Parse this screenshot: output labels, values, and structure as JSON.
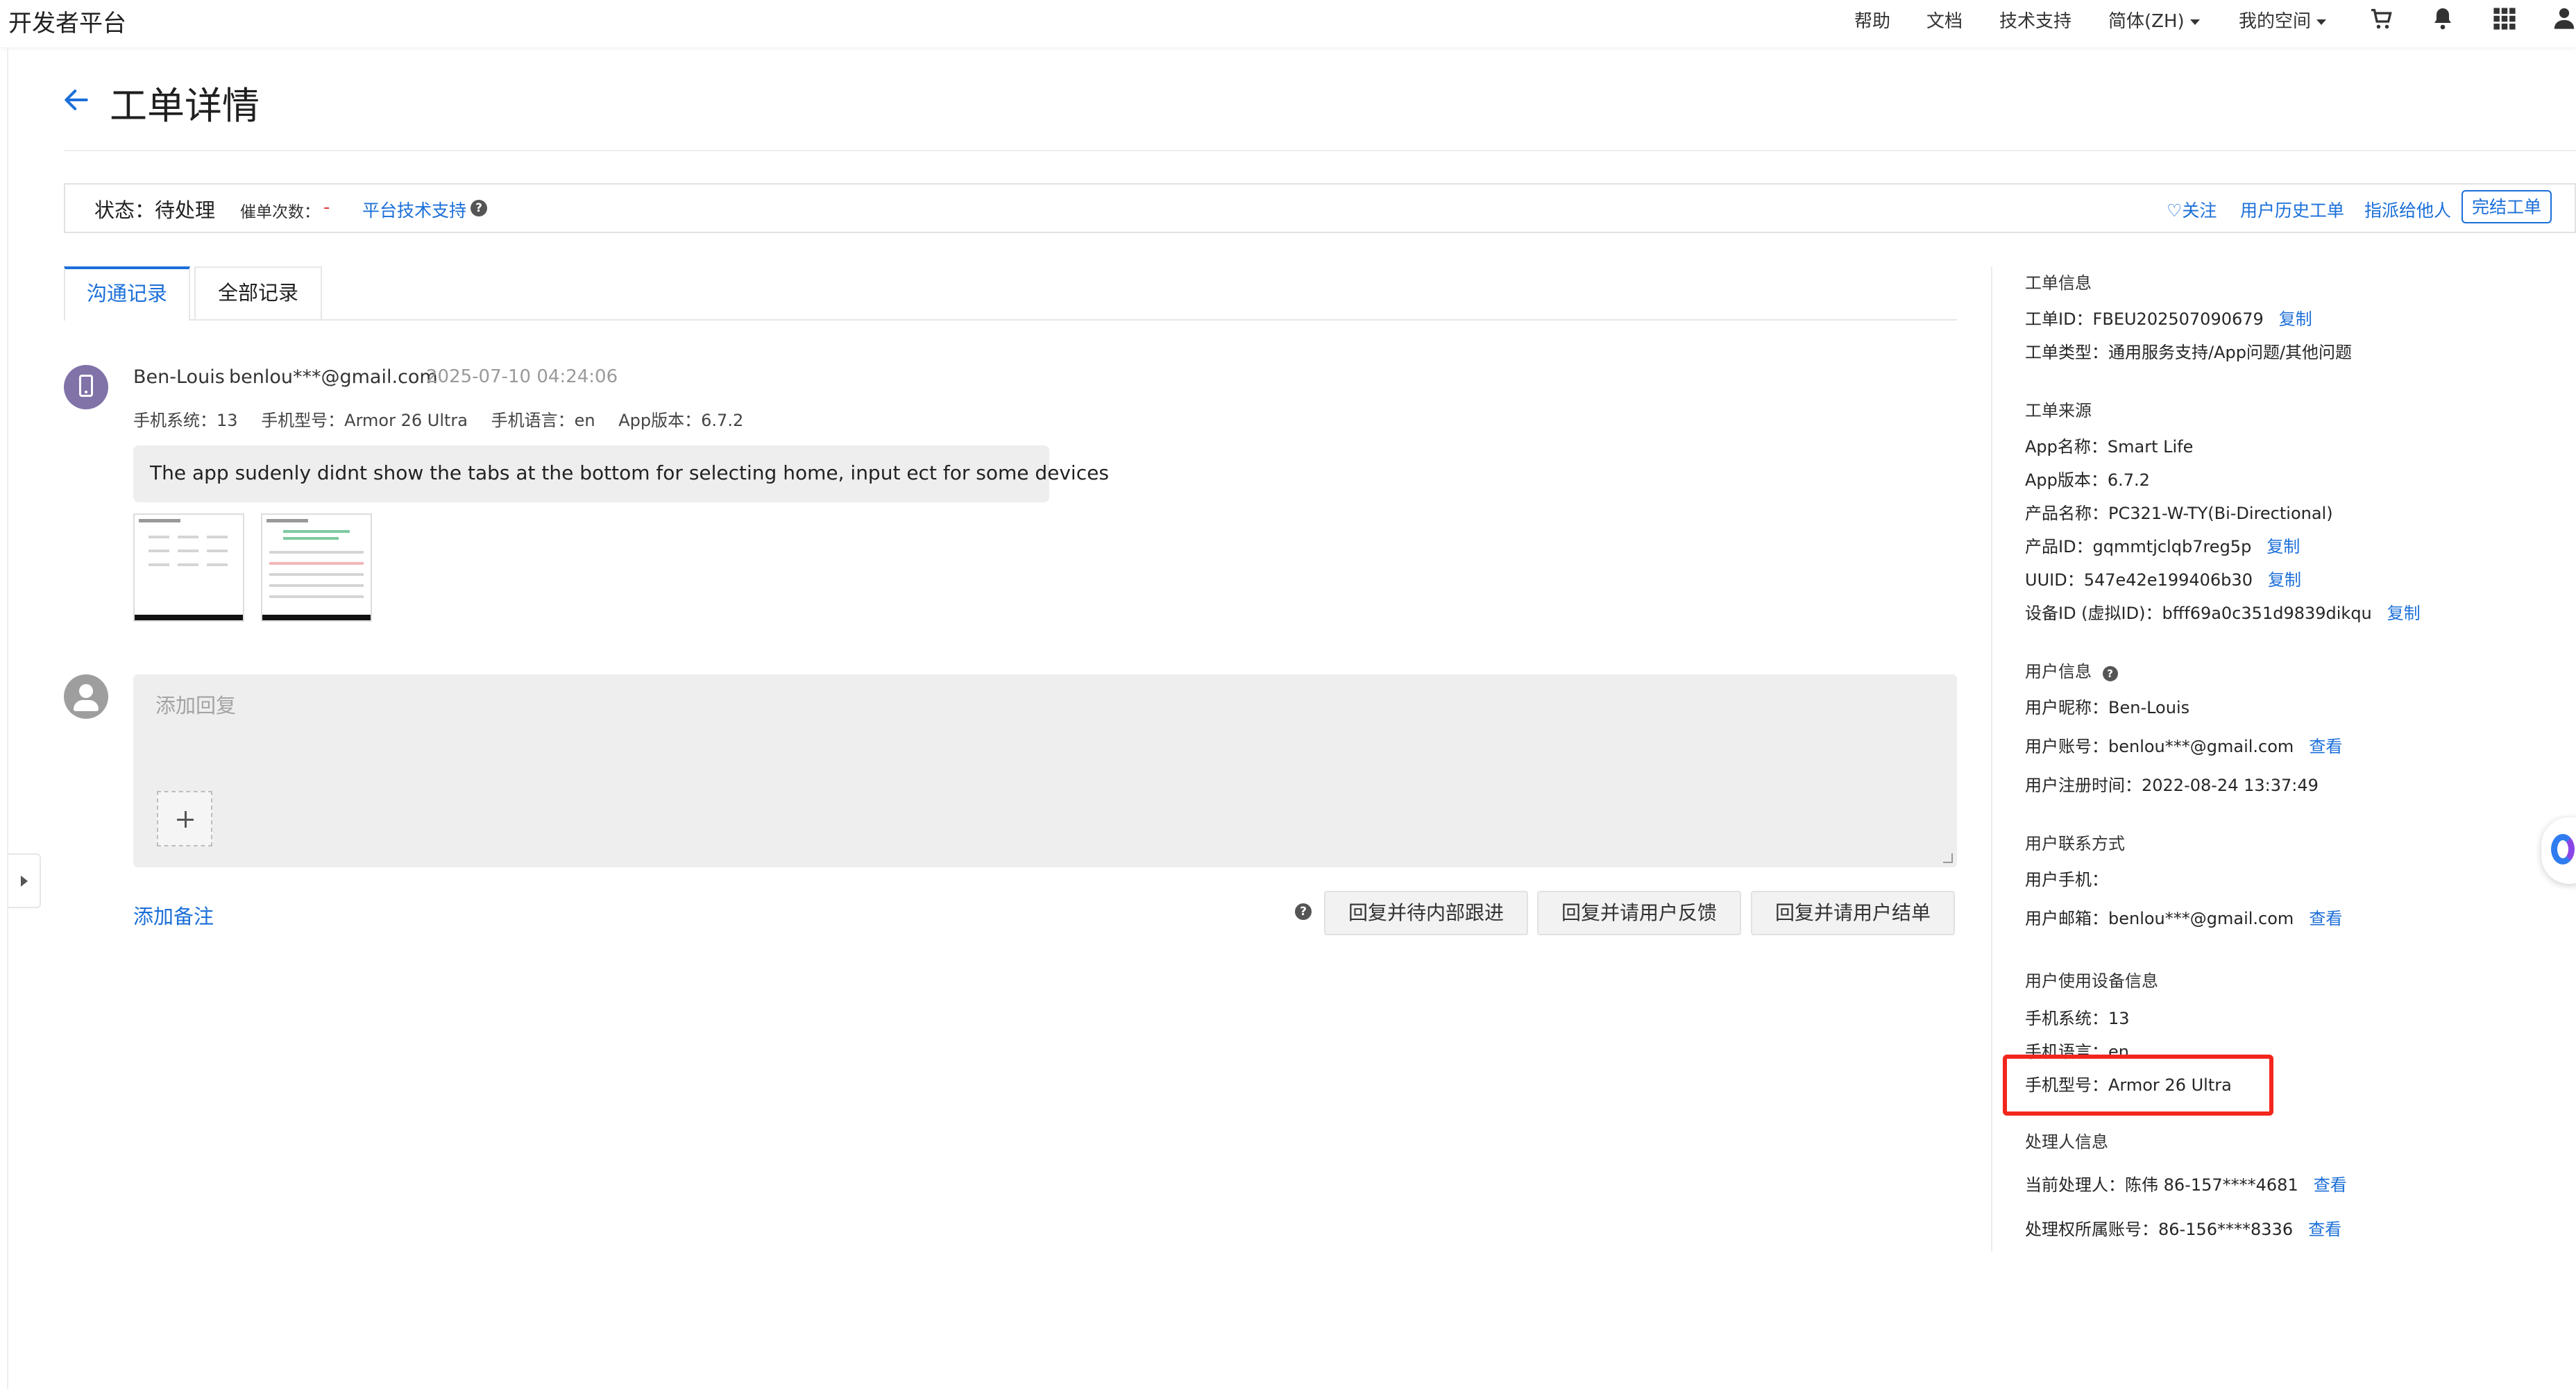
{
  "brand": "开发者平台",
  "nav": {
    "help": "帮助",
    "docs": "文档",
    "support": "技术支持",
    "language": "简体(ZH)",
    "space": "我的空间"
  },
  "header": {
    "title": "工单详情"
  },
  "status_bar": {
    "status": "状态：待处理",
    "urge_label": "催单次数：",
    "urge_value": "-",
    "platform_support": "平台技术支持",
    "follow": "♡关注",
    "user_history": "用户历史工单",
    "assign": "指派给他人",
    "finish": "完结工单"
  },
  "tabs": [
    "沟通记录",
    "全部记录"
  ],
  "message": {
    "author": "Ben-Louis",
    "email": "benlou***@gmail.com",
    "time": "2025-07-10 04:24:06",
    "meta": [
      "手机系统：13",
      "手机型号：Armor 26 Ultra",
      "手机语言：en",
      "App版本：6.7.2"
    ],
    "text": "The app sudenly didnt show the tabs at the bottom for selecting home, input ect for some devices"
  },
  "reply": {
    "placeholder": "添加回复",
    "add_note": "添加备注",
    "buttons": [
      "回复并待内部跟进",
      "回复并请用户反馈",
      "回复并请用户结单"
    ]
  },
  "help_glyph": "?",
  "info": {
    "ticket_head": "工单信息",
    "ticket_id": "工单ID：FBEU202507090679",
    "ticket_type": "工单类型：通用服务支持/App问题/其他问题",
    "source_head": "工单来源",
    "app_name": "App名称：Smart Life",
    "app_version": "App版本：6.7.2",
    "product_name": "产品名称：PC321-W-TY(Bi-Directional)",
    "product_id": "产品ID：gqmmtjclqb7reg5p",
    "uuid": "UUID：547e42e199406b30",
    "device_id": "设备ID (虚拟ID)：bfff69a0c351d9839dikqu",
    "user_head": "用户信息",
    "nickname": "用户昵称：Ben-Louis",
    "account": "用户账号：benlou***@gmail.com",
    "register_time": "用户注册时间：2022-08-24 13:37:49",
    "contact_head": "用户联系方式",
    "phone": "用户手机：",
    "contact_email": "用户邮箱：benlou***@gmail.com",
    "device_head": "用户使用设备信息",
    "os": "手机系统：13",
    "language": "手机语言：en",
    "model": "手机型号：Armor 26 Ultra",
    "handler_head": "处理人信息",
    "current_handler": "当前处理人：陈伟 86-157****4681",
    "owner_account": "处理权所属账号：86-156****8336",
    "copy": "复制",
    "view": "查看"
  },
  "colors": {
    "accent": "#1b6fd9",
    "highlight": "#f2261c",
    "urge": "#e53935"
  }
}
